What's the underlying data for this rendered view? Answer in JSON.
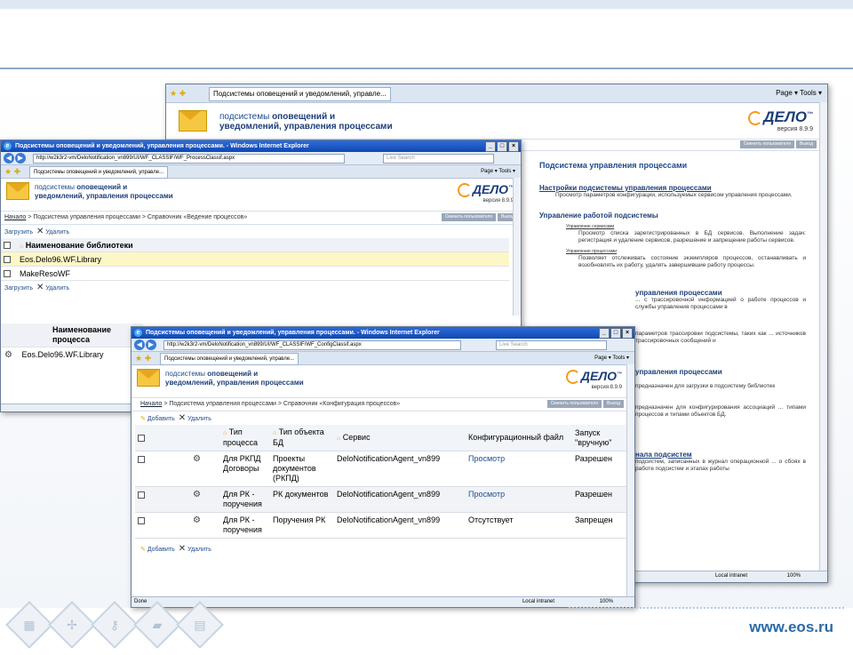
{
  "slide": {
    "footer_url": "www.eos.ru",
    "decor_icons": [
      "table-icon",
      "network-icon",
      "key-icon",
      "folder-icon",
      "document-icon"
    ]
  },
  "colors": {
    "accent": "#1c3e78",
    "ie_title": "#0f48b3",
    "logo_orange": "#f59a1b",
    "footer_url": "#2b6aa5"
  },
  "app": {
    "title_line1": "подсистемы",
    "title_line1_bold": "оповещений и",
    "title_line2": "уведомлений, управления процессами",
    "logo": "ДЕЛО",
    "tm": "™",
    "version": "версия 8.9.9",
    "change_user": "Сменить пользователя",
    "exit": "Выход"
  },
  "back_window": {
    "tab": "Подсистемы оповещений и уведомлений, управле...",
    "tools": "Page ▾  Tools ▾",
    "section_title": "Подсистема управления процессами",
    "items": [
      {
        "title": "Настройки подсистемы управления процессами",
        "text": "Просмотр параметров конфигурации, используемых сервисом управления процессами."
      },
      {
        "title": "Управление работой подсистемы",
        "sub": [
          {
            "label": "Управление сервисами",
            "text": "Просмотр списка зарегистрированных в БД сервисов. Выполнение задач: регистрация и удаление сервисов, разрешение и запрещение работы сервисов."
          },
          {
            "label": "Управление процессами",
            "text": "Позволяет отслеживать состояние экземпляров процессов, останавливать и возобновлять их работу, удалять завершившие работу процессы."
          }
        ]
      },
      {
        "title": "управления процессами",
        "text": "... с трассировочной информацией о работе процессов и службы управления процессами в"
      },
      {
        "title": "",
        "text": "параметров трассировки подсистемы, таких как ... источников трассировочных сообщений и"
      },
      {
        "title": "управления процессами",
        "text": "предназначен для загрузки в подсистему библиотек"
      },
      {
        "title": "",
        "text": "предназначен для конфигурирования ассоциаций ... типами процессов и типами объектов БД."
      },
      {
        "title": "нала подсистем",
        "text": "подсистем, записанных в журнал операционной ... о сбоях в работе подсистем и этапах работы"
      }
    ],
    "status_zone": "Local intranet",
    "status_zoom": "100%"
  },
  "mid_window": {
    "title": "Подсистемы оповещений и уведомлений, управления процессами. - Windows Internet Explorer",
    "url": "http://w2k3r2-vm/DeloNotification_vn899/UI/WF_CLASSIF/WF_ProcessClassif.aspx",
    "search_placeholder": "Live Search",
    "tab": "Подсистемы оповещений и уведомлений, управле...",
    "tools": "Page ▾  Tools ▾",
    "breadcrumb_home": "Начало",
    "breadcrumb_rest": " > Подсистема управления процессами > Справочник «Ведение процессов»",
    "upload": "Загрузить",
    "delete": "Удалить",
    "col_name": "Наименование библиотеки",
    "rows": [
      "Eos.Delo96.WF.Library",
      "MakeResoWF"
    ],
    "col_process": "Наименование процесса",
    "process_rows": [
      "Eos.Delo96.WF.Library"
    ]
  },
  "front_window": {
    "title": "Подсистемы оповещений и уведомлений, управления процессами. - Windows Internet Explorer",
    "url": "http://w2k3r2-vm/DeloNotification_vn899/UI/WF_CLASSIF/WF_ConfigClassif.aspx",
    "search_placeholder": "Live Search",
    "tab": "Подсистемы оповещений и уведомлений, управле...",
    "tools": "Page ▾  Tools ▾",
    "breadcrumb_home": "Начало",
    "breadcrumb_rest": " > Подсистема управления процессами > Справочник «Конфигурация процессов»",
    "add": "Добавить",
    "delete": "Удалить",
    "headers": [
      "Тип процесса",
      "Тип объекта БД",
      "Сервис",
      "Конфигурационный файл",
      "Запуск \"вручную\""
    ],
    "rows": [
      {
        "type": "Для РКПД Договоры",
        "object": "Проекты документов (РКПД)",
        "service": "DeloNotificationAgent_vn899",
        "file": "Просмотр",
        "manual": "Разрешен"
      },
      {
        "type": "Для РК - поручения",
        "object": "РК документов",
        "service": "DeloNotificationAgent_vn899",
        "file": "Просмотр",
        "manual": "Разрешен"
      },
      {
        "type": "Для РК - поручения",
        "object": "Поручения РК",
        "service": "DeloNotificationAgent_vn899",
        "file": "Отсутствует",
        "manual": "Запрещен"
      }
    ],
    "status_done": "Done",
    "status_zone": "Local intranet",
    "status_zoom": "100%"
  }
}
